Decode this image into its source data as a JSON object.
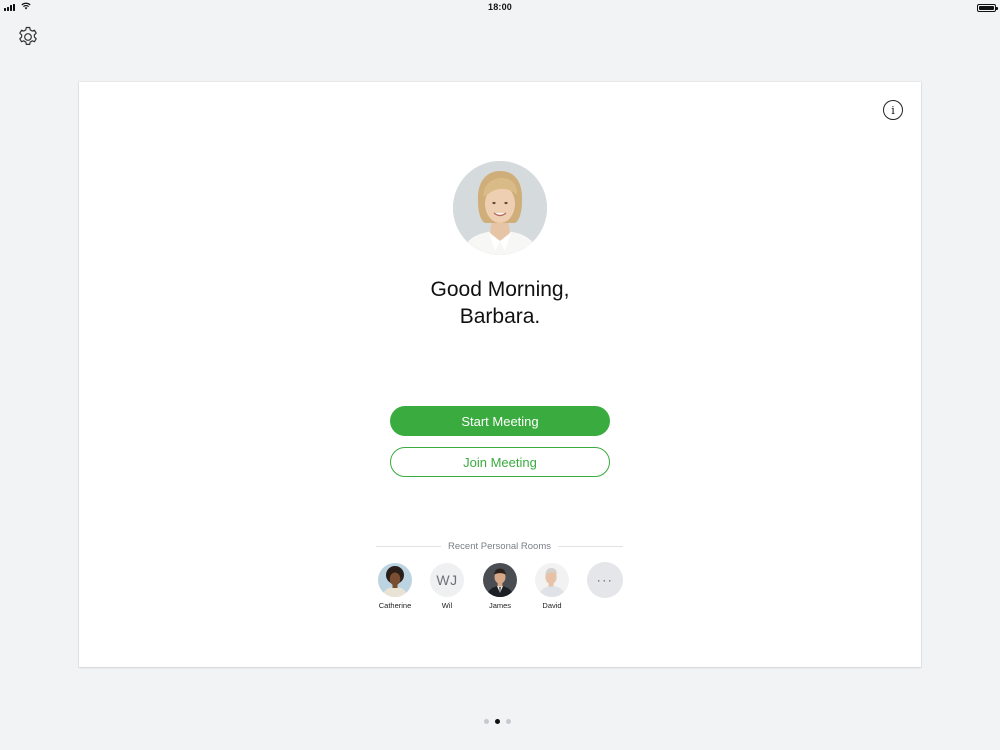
{
  "status_bar": {
    "time": "18:00"
  },
  "card": {
    "greeting_line1": "Good Morning,",
    "greeting_line2": "Barbara.",
    "start_button_label": "Start Meeting",
    "join_button_label": "Join Meeting",
    "recent_rooms_label": "Recent Personal Rooms",
    "recent_rooms": [
      {
        "name": "Catherine",
        "type": "photo"
      },
      {
        "name": "Wil",
        "initials": "WJ",
        "type": "initials"
      },
      {
        "name": "James",
        "type": "photo"
      },
      {
        "name": "David",
        "type": "photo"
      }
    ],
    "more_label": "···",
    "info_icon": "i"
  },
  "icons": {
    "settings": "gear-icon",
    "info": "info-icon",
    "more": "more-icon"
  },
  "colors": {
    "accent_green": "#3aab3f",
    "background": "#f2f3f5",
    "card": "#ffffff"
  },
  "pagination": {
    "pages": 3,
    "current": 2
  }
}
